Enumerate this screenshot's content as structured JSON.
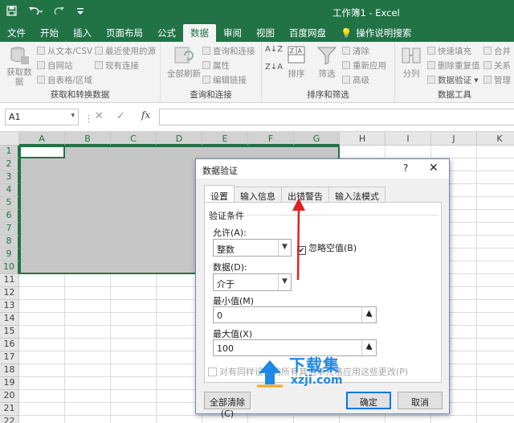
{
  "window": {
    "title": "工作簿1 - Excel"
  },
  "quick_access": [
    "save-icon",
    "undo-icon",
    "redo-icon",
    "customize-icon"
  ],
  "tabs": [
    {
      "label": "文件"
    },
    {
      "label": "开始"
    },
    {
      "label": "插入"
    },
    {
      "label": "页面布局"
    },
    {
      "label": "公式"
    },
    {
      "label": "数据",
      "active": true
    },
    {
      "label": "审阅"
    },
    {
      "label": "视图"
    },
    {
      "label": "百度网盘"
    },
    {
      "label": "操作说明搜索"
    }
  ],
  "ribbon": {
    "get_transform": {
      "label": "获取和转换数据",
      "get_data": "获取数\n据",
      "from_text": "从文本/CSV",
      "from_web": "自网站",
      "from_table": "自表格/区域",
      "recent_sources": "最近使用的源",
      "existing_conn": "现有连接"
    },
    "queries": {
      "label": "查询和连接",
      "refresh_all": "全部刷新",
      "queries_conn": "查询和连接",
      "properties": "属性",
      "edit_links": "编辑链接"
    },
    "sort_filter": {
      "label": "排序和筛选",
      "sort": "排序",
      "filter": "筛选",
      "clear": "清除",
      "reapply": "重新应用",
      "advanced": "高级"
    },
    "data_tools": {
      "label": "数据工具",
      "split": "分列",
      "flash_fill": "快速填充",
      "remove_dup": "删除重复值",
      "validation": "数据验证",
      "merge": "合并",
      "relations": "关系",
      "manage": "管理"
    }
  },
  "formula_bar": {
    "name_box": "A1",
    "fx": "fx"
  },
  "columns": [
    "A",
    "B",
    "C",
    "D",
    "E",
    "F",
    "G",
    "H",
    "I",
    "J",
    "K"
  ],
  "rows": [
    "1",
    "2",
    "3",
    "4",
    "5",
    "6",
    "7",
    "8",
    "9",
    "10",
    "11",
    "12",
    "13",
    "14",
    "15",
    "16",
    "17",
    "18",
    "19",
    "20",
    "21",
    "22"
  ],
  "dialog": {
    "title": "数据验证",
    "help": "?",
    "close": "✕",
    "tabs": [
      "设置",
      "输入信息",
      "出错警告",
      "输入法模式"
    ],
    "section": "验证条件",
    "allow_label": "允许(A):",
    "allow_value": "整数",
    "ignore_blank": "忽略空值(B)",
    "data_label": "数据(D):",
    "data_value": "介于",
    "min_label": "最小值(M)",
    "min_value": "0",
    "max_label": "最大值(X)",
    "max_value": "100",
    "apply_all": "对有同样设置的所有其他单元格应用这些更改(P)",
    "clear_all": "全部清除(C)",
    "ok": "确定",
    "cancel": "取消"
  },
  "watermark": {
    "cn": "下载集",
    "url": "xzji.com"
  },
  "colors": {
    "excel_green": "#217346",
    "annotation_red": "#e02020",
    "watermark_blue": "#1e88e5"
  }
}
